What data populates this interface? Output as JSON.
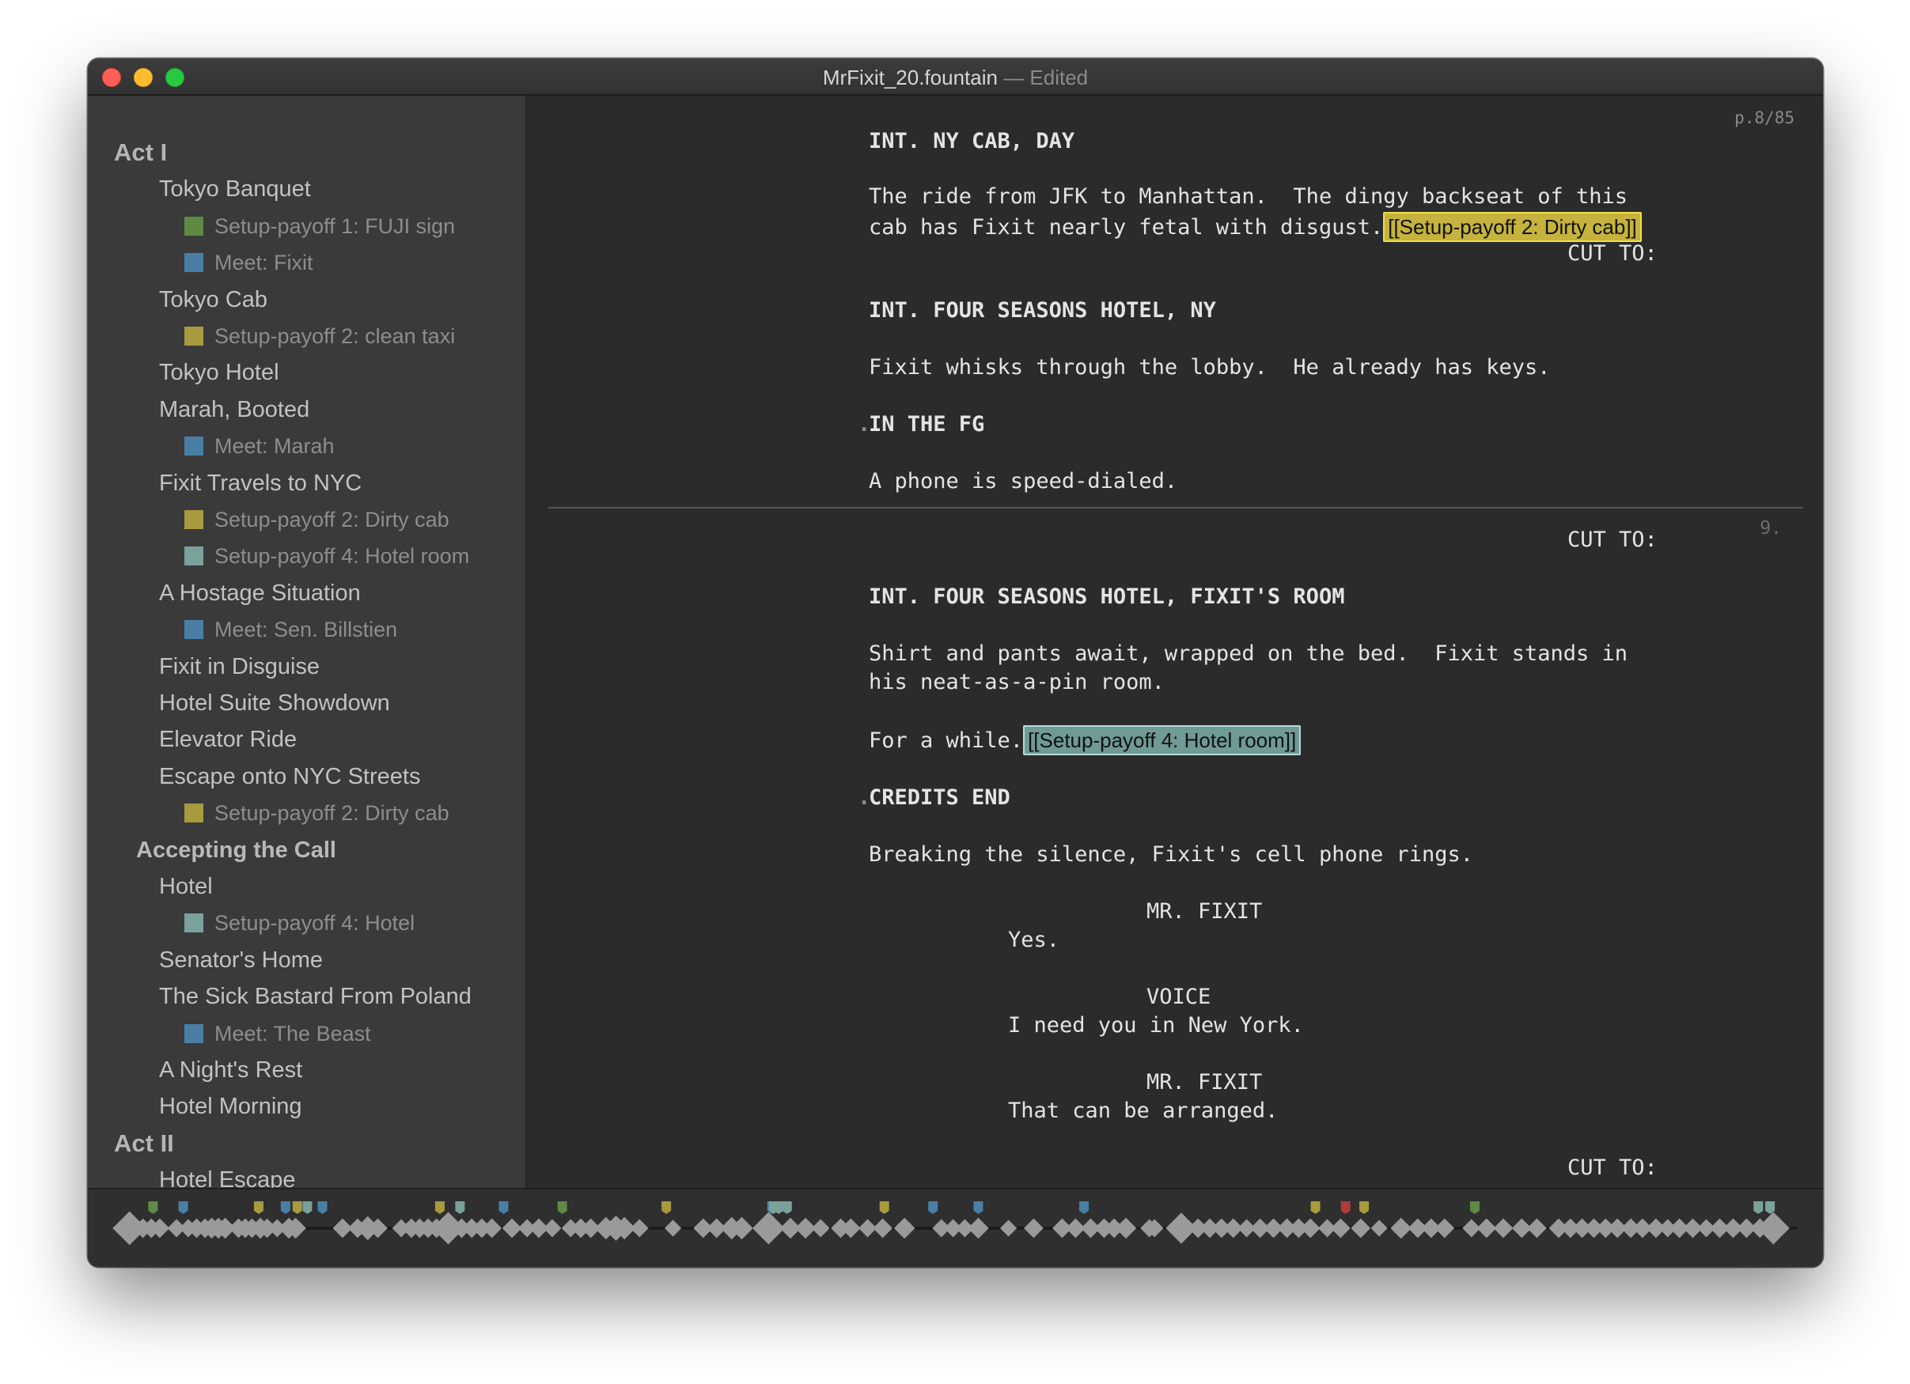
{
  "window": {
    "title": "MrFixit_20.fountain",
    "title_suffix": "— Edited"
  },
  "colors": {
    "green": "#5e8a44",
    "blue": "#4a7fa5",
    "yellow": "#a89a3e",
    "teal": "#7aa19b",
    "red": "#b23a3a"
  },
  "outline": [
    {
      "kind": "act",
      "label": "Act I"
    },
    {
      "kind": "scene",
      "label": "Tokyo Banquet"
    },
    {
      "kind": "note",
      "label": "Setup-payoff 1: FUJI sign",
      "color": "#5e8a44"
    },
    {
      "kind": "note",
      "label": "Meet: Fixit",
      "color": "#4a7fa5"
    },
    {
      "kind": "scene",
      "label": "Tokyo Cab"
    },
    {
      "kind": "note",
      "label": "Setup-payoff 2: clean taxi",
      "color": "#a89a3e"
    },
    {
      "kind": "scene",
      "label": "Tokyo Hotel"
    },
    {
      "kind": "scene",
      "label": "Marah, Booted"
    },
    {
      "kind": "note",
      "label": "Meet: Marah",
      "color": "#4a7fa5"
    },
    {
      "kind": "scene",
      "label": "Fixit Travels to NYC"
    },
    {
      "kind": "note",
      "label": "Setup-payoff 2: Dirty cab",
      "color": "#a89a3e"
    },
    {
      "kind": "note",
      "label": "Setup-payoff 4: Hotel room",
      "color": "#7aa19b"
    },
    {
      "kind": "scene",
      "label": "A Hostage Situation"
    },
    {
      "kind": "note",
      "label": "Meet: Sen. Billstien",
      "color": "#4a7fa5"
    },
    {
      "kind": "scene",
      "label": "Fixit in Disguise"
    },
    {
      "kind": "scene",
      "label": "Hotel Suite Showdown"
    },
    {
      "kind": "scene",
      "label": "Elevator Ride"
    },
    {
      "kind": "scene",
      "label": "Escape onto NYC Streets"
    },
    {
      "kind": "note",
      "label": "Setup-payoff 2: Dirty cab",
      "color": "#a89a3e"
    },
    {
      "kind": "seq",
      "label": "Accepting the Call"
    },
    {
      "kind": "scene",
      "label": "Hotel"
    },
    {
      "kind": "note",
      "label": "Setup-payoff 4: Hotel",
      "color": "#7aa19b"
    },
    {
      "kind": "scene",
      "label": "Senator's Home"
    },
    {
      "kind": "scene",
      "label": "The Sick Bastard From Poland"
    },
    {
      "kind": "note",
      "label": "Meet: The Beast",
      "color": "#4a7fa5"
    },
    {
      "kind": "scene",
      "label": "A Night's Rest"
    },
    {
      "kind": "scene",
      "label": "Hotel Morning"
    },
    {
      "kind": "act",
      "label": "Act II"
    },
    {
      "kind": "scene",
      "label": "Hotel Escape"
    }
  ],
  "editor": {
    "page_indicator": "p.8/85",
    "page_break_number": "9.",
    "lines": {
      "heading1": "INT. NY CAB, DAY",
      "action1a": "The ride from JFK to Manhattan.  The dingy backseat of this",
      "action1b": "cab has Fixit nearly fetal with disgust.",
      "note1": "[[Setup-payoff 2: Dirty cab]]",
      "trans1": "CUT TO:",
      "heading2": "INT. FOUR SEASONS HOTEL, NY",
      "action2": "Fixit whisks through the lobby.  He already has keys.",
      "shot1": "IN THE FG",
      "action3": "A phone is speed-dialed.",
      "trans2": "CUT TO:",
      "heading3": "INT. FOUR SEASONS HOTEL, FIXIT'S ROOM",
      "action4a": "Shirt and pants await, wrapped on the bed.  Fixit stands in",
      "action4b": "his neat-as-a-pin room.",
      "action5": "For a while.",
      "note2": "[[Setup-payoff 4: Hotel room]]",
      "shot2": "CREDITS END",
      "action6": "Breaking the silence, Fixit's cell phone rings.",
      "char1": "MR. FIXIT",
      "dial1": "Yes.",
      "char2": "VOICE",
      "dial2": "I need you in New York.",
      "char3": "MR. FIXIT",
      "dial3": "That can be arranged.",
      "trans3": "CUT TO:"
    }
  },
  "timeline": {
    "scene_marks": [
      {
        "x": 0.006,
        "size": 1.6
      },
      {
        "x": 0.014,
        "size": 0.6
      },
      {
        "x": 0.019,
        "size": 0.6
      },
      {
        "x": 0.024,
        "size": 0.6
      },
      {
        "x": 0.034,
        "size": 0.5
      },
      {
        "x": 0.041,
        "size": 0.5
      },
      {
        "x": 0.046,
        "size": 0.6
      },
      {
        "x": 0.051,
        "size": 0.6
      },
      {
        "x": 0.055,
        "size": 0.7
      },
      {
        "x": 0.059,
        "size": 0.7
      },
      {
        "x": 0.063,
        "size": 0.7
      },
      {
        "x": 0.071,
        "size": 0.6
      },
      {
        "x": 0.075,
        "size": 0.6
      },
      {
        "x": 0.079,
        "size": 0.6
      },
      {
        "x": 0.084,
        "size": 0.7
      },
      {
        "x": 0.088,
        "size": 0.6
      },
      {
        "x": 0.094,
        "size": 0.5
      },
      {
        "x": 0.101,
        "size": 0.7
      },
      {
        "x": 0.105,
        "size": 0.7
      },
      {
        "x": 0.133,
        "size": 0.6
      },
      {
        "x": 0.142,
        "size": 0.6
      },
      {
        "x": 0.148,
        "size": 0.9
      },
      {
        "x": 0.154,
        "size": 0.6
      },
      {
        "x": 0.168,
        "size": 0.5
      },
      {
        "x": 0.174,
        "size": 0.6
      },
      {
        "x": 0.179,
        "size": 0.6
      },
      {
        "x": 0.184,
        "size": 0.6
      },
      {
        "x": 0.189,
        "size": 0.6
      },
      {
        "x": 0.196,
        "size": 1.5
      },
      {
        "x": 0.204,
        "size": 0.6
      },
      {
        "x": 0.21,
        "size": 0.6
      },
      {
        "x": 0.216,
        "size": 0.6
      },
      {
        "x": 0.222,
        "size": 0.6
      },
      {
        "x": 0.234,
        "size": 0.6
      },
      {
        "x": 0.243,
        "size": 0.5
      },
      {
        "x": 0.25,
        "size": 0.6
      },
      {
        "x": 0.258,
        "size": 0.5
      },
      {
        "x": 0.269,
        "size": 0.5
      },
      {
        "x": 0.275,
        "size": 0.6
      },
      {
        "x": 0.281,
        "size": 0.6
      },
      {
        "x": 0.29,
        "size": 0.8
      },
      {
        "x": 0.296,
        "size": 1.0
      },
      {
        "x": 0.301,
        "size": 0.8
      },
      {
        "x": 0.31,
        "size": 0.5
      },
      {
        "x": 0.33,
        "size": 0.4
      },
      {
        "x": 0.348,
        "size": 0.6
      },
      {
        "x": 0.356,
        "size": 0.6
      },
      {
        "x": 0.365,
        "size": 0.8
      },
      {
        "x": 0.371,
        "size": 0.8
      },
      {
        "x": 0.387,
        "size": 1.5
      },
      {
        "x": 0.4,
        "size": 0.7
      },
      {
        "x": 0.409,
        "size": 0.7
      },
      {
        "x": 0.418,
        "size": 0.5
      },
      {
        "x": 0.43,
        "size": 0.6
      },
      {
        "x": 0.436,
        "size": 0.6
      },
      {
        "x": 0.446,
        "size": 0.5
      },
      {
        "x": 0.455,
        "size": 0.6
      },
      {
        "x": 0.468,
        "size": 0.7
      },
      {
        "x": 0.49,
        "size": 0.5
      },
      {
        "x": 0.497,
        "size": 0.5
      },
      {
        "x": 0.504,
        "size": 0.5
      },
      {
        "x": 0.512,
        "size": 0.7
      },
      {
        "x": 0.53,
        "size": 0.4
      },
      {
        "x": 0.545,
        "size": 0.6
      },
      {
        "x": 0.562,
        "size": 0.6
      },
      {
        "x": 0.57,
        "size": 0.6
      },
      {
        "x": 0.579,
        "size": 0.6
      },
      {
        "x": 0.587,
        "size": 0.6
      },
      {
        "x": 0.593,
        "size": 0.6
      },
      {
        "x": 0.6,
        "size": 0.7
      },
      {
        "x": 0.614,
        "size": 0.5
      },
      {
        "x": 0.617,
        "size": 0.5
      },
      {
        "x": 0.633,
        "size": 1.4
      },
      {
        "x": 0.643,
        "size": 0.6
      },
      {
        "x": 0.65,
        "size": 0.6
      },
      {
        "x": 0.657,
        "size": 0.6
      },
      {
        "x": 0.664,
        "size": 0.6
      },
      {
        "x": 0.672,
        "size": 0.5
      },
      {
        "x": 0.68,
        "size": 0.6
      },
      {
        "x": 0.688,
        "size": 0.6
      },
      {
        "x": 0.696,
        "size": 0.6
      },
      {
        "x": 0.703,
        "size": 0.6
      },
      {
        "x": 0.71,
        "size": 0.6
      },
      {
        "x": 0.72,
        "size": 0.5
      },
      {
        "x": 0.728,
        "size": 0.6
      },
      {
        "x": 0.74,
        "size": 0.6
      },
      {
        "x": 0.751,
        "size": 0.4
      },
      {
        "x": 0.764,
        "size": 0.7
      },
      {
        "x": 0.774,
        "size": 0.6
      },
      {
        "x": 0.782,
        "size": 0.6
      },
      {
        "x": 0.79,
        "size": 0.6
      },
      {
        "x": 0.806,
        "size": 0.5
      },
      {
        "x": 0.815,
        "size": 0.6
      },
      {
        "x": 0.825,
        "size": 0.6
      },
      {
        "x": 0.836,
        "size": 0.6
      },
      {
        "x": 0.845,
        "size": 0.6
      },
      {
        "x": 0.858,
        "size": 0.6
      },
      {
        "x": 0.865,
        "size": 0.6
      },
      {
        "x": 0.872,
        "size": 0.6
      },
      {
        "x": 0.879,
        "size": 0.6
      },
      {
        "x": 0.886,
        "size": 0.6
      },
      {
        "x": 0.893,
        "size": 0.6
      },
      {
        "x": 0.901,
        "size": 0.6
      },
      {
        "x": 0.908,
        "size": 0.6
      },
      {
        "x": 0.916,
        "size": 0.6
      },
      {
        "x": 0.923,
        "size": 0.5
      },
      {
        "x": 0.93,
        "size": 0.6
      },
      {
        "x": 0.938,
        "size": 0.6
      },
      {
        "x": 0.946,
        "size": 0.5
      },
      {
        "x": 0.954,
        "size": 0.6
      },
      {
        "x": 0.962,
        "size": 0.6
      },
      {
        "x": 0.97,
        "size": 0.6
      },
      {
        "x": 0.978,
        "size": 0.6
      },
      {
        "x": 0.986,
        "size": 1.5
      }
    ],
    "flag_marks": [
      {
        "x": 0.02,
        "color": "#5e8a44"
      },
      {
        "x": 0.038,
        "color": "#4a7fa5"
      },
      {
        "x": 0.083,
        "color": "#a89a3e"
      },
      {
        "x": 0.099,
        "color": "#4a7fa5"
      },
      {
        "x": 0.106,
        "color": "#a89a3e"
      },
      {
        "x": 0.112,
        "color": "#7aa19b"
      },
      {
        "x": 0.121,
        "color": "#4a7fa5"
      },
      {
        "x": 0.191,
        "color": "#a89a3e"
      },
      {
        "x": 0.203,
        "color": "#7aa19b"
      },
      {
        "x": 0.229,
        "color": "#4a7fa5"
      },
      {
        "x": 0.264,
        "color": "#5e8a44"
      },
      {
        "x": 0.326,
        "color": "#a89a3e"
      },
      {
        "x": 0.389,
        "color": "#4a7fa5"
      },
      {
        "x": 0.39,
        "color": "#7aa19b"
      },
      {
        "x": 0.393,
        "color": "#7aa19b"
      },
      {
        "x": 0.398,
        "color": "#7aa19b"
      },
      {
        "x": 0.456,
        "color": "#a89a3e"
      },
      {
        "x": 0.485,
        "color": "#4a7fa5"
      },
      {
        "x": 0.512,
        "color": "#4a7fa5"
      },
      {
        "x": 0.575,
        "color": "#4a7fa5"
      },
      {
        "x": 0.713,
        "color": "#a89a3e"
      },
      {
        "x": 0.731,
        "color": "#b23a3a"
      },
      {
        "x": 0.742,
        "color": "#a89a3e"
      },
      {
        "x": 0.808,
        "color": "#5e8a44"
      },
      {
        "x": 0.977,
        "color": "#7aa19b"
      },
      {
        "x": 0.984,
        "color": "#7aa19b"
      }
    ]
  }
}
